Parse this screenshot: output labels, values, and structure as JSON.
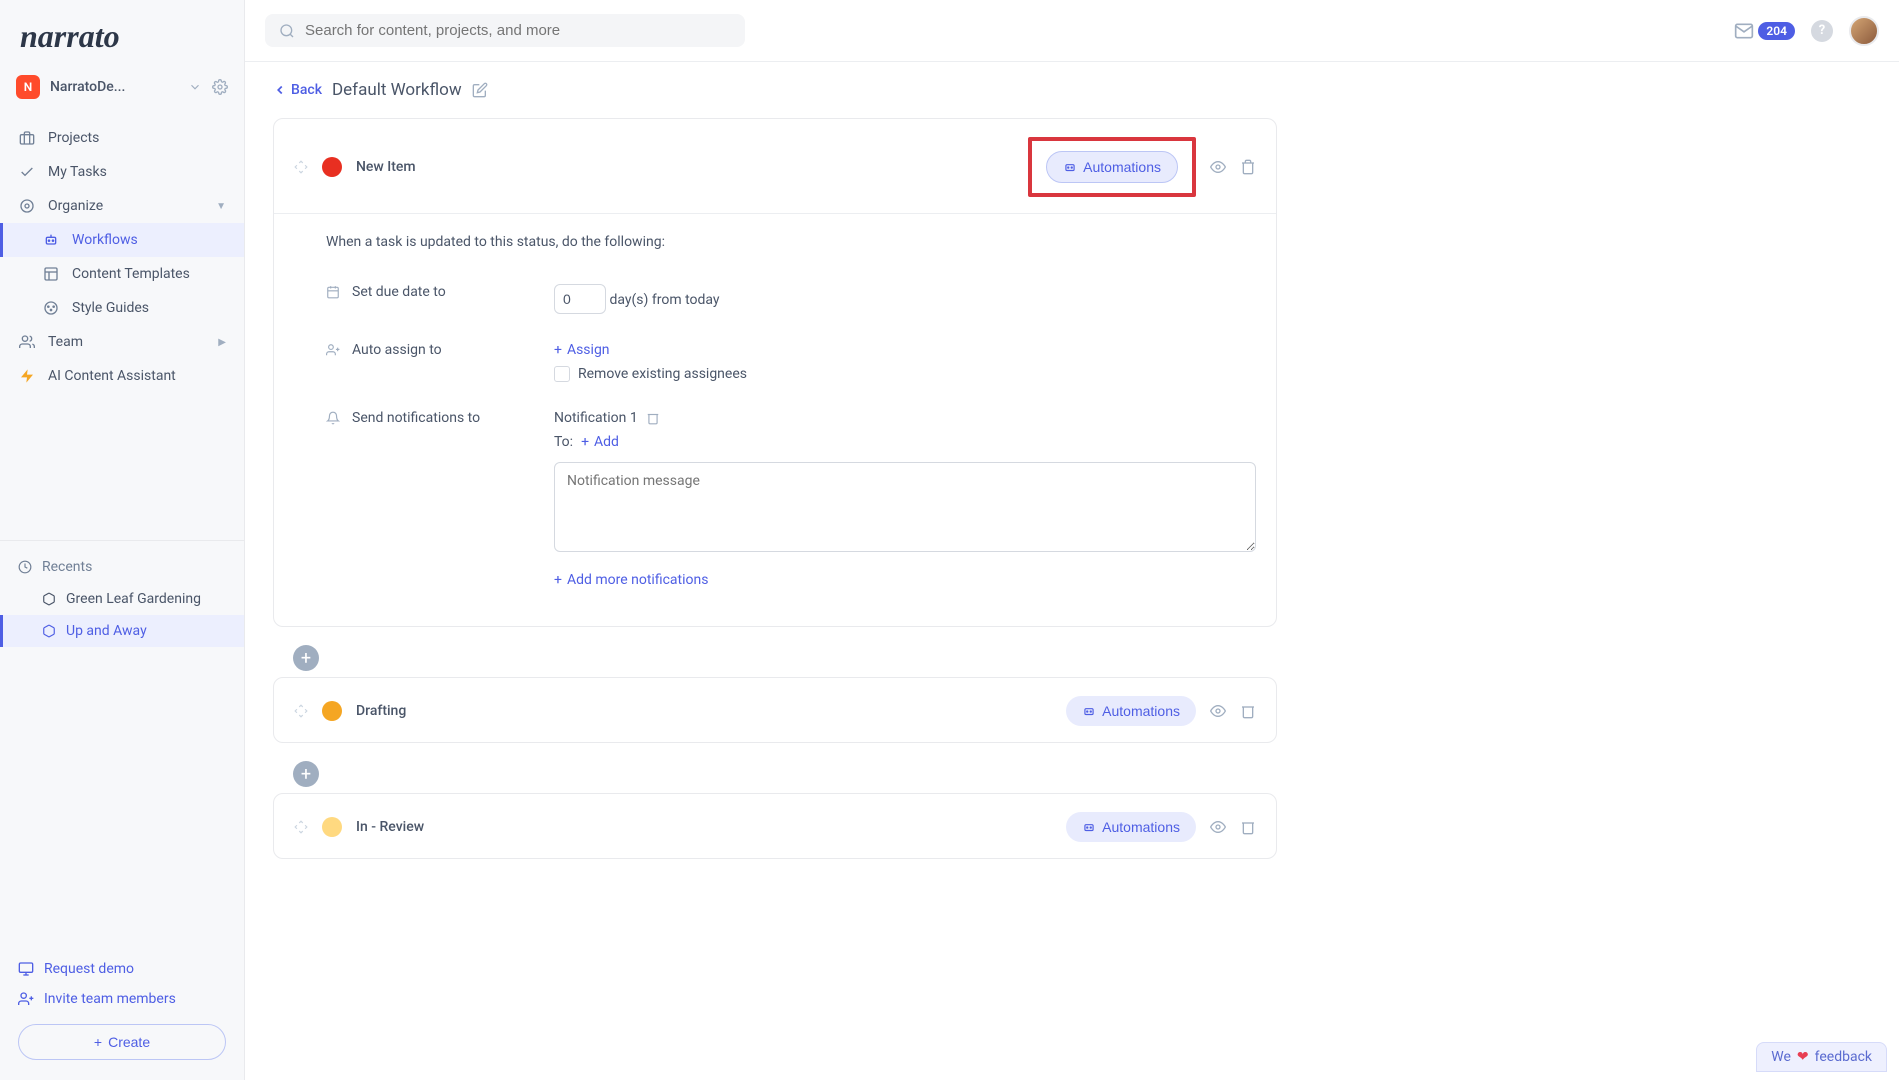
{
  "logo": "narrato",
  "workspace": {
    "initial": "N",
    "name": "NarratoDe..."
  },
  "nav": {
    "projects": "Projects",
    "mytasks": "My Tasks",
    "organize": "Organize",
    "workflows": "Workflows",
    "templates": "Content Templates",
    "styleguides": "Style Guides",
    "team": "Team",
    "ai": "AI Content Assistant"
  },
  "recents": {
    "heading": "Recents",
    "items": [
      "Green Leaf Gardening",
      "Up and Away"
    ]
  },
  "footer": {
    "demo": "Request demo",
    "invite": "Invite team members",
    "create": "Create"
  },
  "search": {
    "placeholder": "Search for content, projects, and more"
  },
  "notif_count": "204",
  "breadcrumb": {
    "back": "Back",
    "title": "Default Workflow"
  },
  "automations_label": "Automations",
  "body_intro": "When a task is updated to this status, do the following:",
  "rows": {
    "due": {
      "label": "Set due date to",
      "value": "0",
      "suffix": "day(s) from today"
    },
    "assign": {
      "label": "Auto assign to",
      "btn": "Assign",
      "checkbox": "Remove existing assignees"
    },
    "notify": {
      "label": "Send notifications to",
      "n1": "Notification 1",
      "to": "To:",
      "add": "Add",
      "placeholder": "Notification message",
      "more": "Add more notifications"
    }
  },
  "statuses": [
    {
      "name": "New Item",
      "color": "#e82f21",
      "expanded": true,
      "highlight": true
    },
    {
      "name": "Drafting",
      "color": "#f5a623",
      "expanded": false
    },
    {
      "name": "In - Review",
      "color": "#ffd980",
      "expanded": false
    }
  ],
  "feedback": {
    "pre": "We",
    "post": "feedback"
  }
}
